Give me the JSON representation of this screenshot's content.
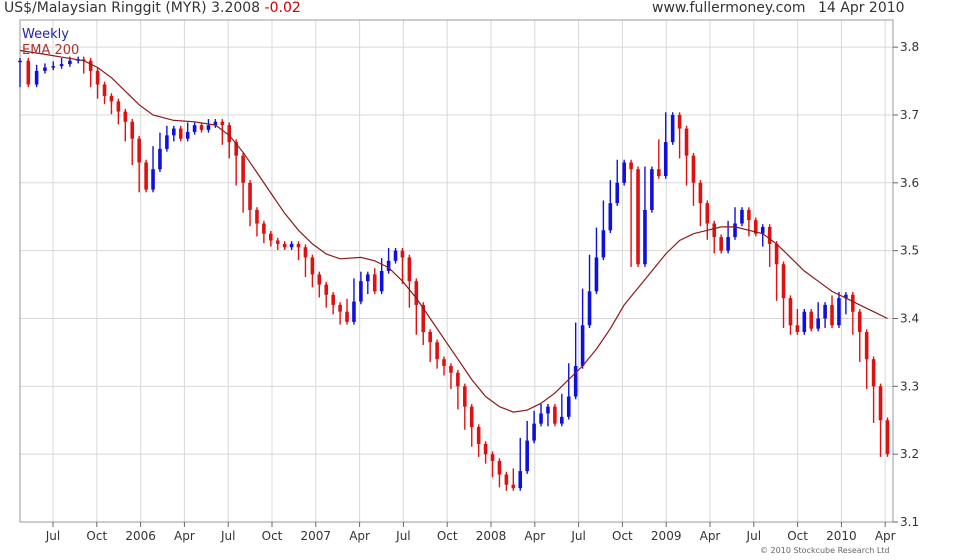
{
  "header": {
    "instrument": "US$/Malaysian Ringgit (MYR) 3.2008",
    "change": "-0.02",
    "website": "www.fullermoney.com",
    "date": "14 Apr 2010"
  },
  "legend": {
    "weekly": "Weekly",
    "ema": "EMA 200"
  },
  "copyright": "© 2010 Stockcube Research Ltd",
  "colors": {
    "up": "#1010dd",
    "down": "#e01010",
    "ema": "#8b1a1a",
    "grid": "#d8d8d8"
  },
  "chart_data": {
    "type": "candlestick",
    "x_tick_labels": [
      "Jul",
      "Oct",
      "2006",
      "Apr",
      "Jul",
      "Oct",
      "2007",
      "Apr",
      "Jul",
      "Oct",
      "2008",
      "Apr",
      "Jul",
      "Oct",
      "2009",
      "Apr",
      "Jul",
      "Oct",
      "2010",
      "Apr"
    ],
    "y_ticks": [
      3.1,
      3.2,
      3.3,
      3.4,
      3.5,
      3.6,
      3.7,
      3.8
    ],
    "ylim": [
      3.1,
      3.84
    ],
    "y_axis_side": "right",
    "grid": true,
    "series": [
      {
        "name": "Weekly",
        "points": [
          [
            2005.54,
            3.78
          ],
          [
            2005.6,
            3.745
          ],
          [
            2005.66,
            3.765
          ],
          [
            2005.72,
            3.77
          ],
          [
            2005.78,
            3.772
          ],
          [
            2005.84,
            3.775
          ],
          [
            2005.9,
            3.78
          ],
          [
            2005.96,
            3.782
          ],
          [
            2006.0,
            3.78
          ],
          [
            2006.05,
            3.765
          ],
          [
            2006.1,
            3.745
          ],
          [
            2006.15,
            3.728
          ],
          [
            2006.2,
            3.72
          ],
          [
            2006.25,
            3.705
          ],
          [
            2006.3,
            3.69
          ],
          [
            2006.35,
            3.665
          ],
          [
            2006.4,
            3.63
          ],
          [
            2006.45,
            3.59
          ],
          [
            2006.5,
            3.62
          ],
          [
            2006.55,
            3.65
          ],
          [
            2006.6,
            3.67
          ],
          [
            2006.65,
            3.68
          ],
          [
            2006.7,
            3.665
          ],
          [
            2006.75,
            3.675
          ],
          [
            2006.8,
            3.685
          ],
          [
            2006.85,
            3.678
          ],
          [
            2006.9,
            3.685
          ],
          [
            2006.95,
            3.69
          ],
          [
            2007.0,
            3.685
          ],
          [
            2007.05,
            3.66
          ],
          [
            2007.1,
            3.64
          ],
          [
            2007.15,
            3.6
          ],
          [
            2007.2,
            3.56
          ],
          [
            2007.25,
            3.54
          ],
          [
            2007.3,
            3.525
          ],
          [
            2007.35,
            3.515
          ],
          [
            2007.4,
            3.51
          ],
          [
            2007.45,
            3.505
          ],
          [
            2007.5,
            3.51
          ],
          [
            2007.55,
            3.505
          ],
          [
            2007.6,
            3.49
          ],
          [
            2007.65,
            3.465
          ],
          [
            2007.7,
            3.45
          ],
          [
            2007.75,
            3.435
          ],
          [
            2007.8,
            3.42
          ],
          [
            2007.85,
            3.41
          ],
          [
            2007.9,
            3.395
          ],
          [
            2007.95,
            3.425
          ],
          [
            2008.0,
            3.455
          ],
          [
            2008.05,
            3.465
          ],
          [
            2008.1,
            3.44
          ],
          [
            2008.15,
            3.47
          ],
          [
            2008.2,
            3.485
          ],
          [
            2008.25,
            3.5
          ],
          [
            2008.3,
            3.49
          ],
          [
            2008.35,
            3.455
          ],
          [
            2008.4,
            3.42
          ],
          [
            2008.45,
            3.38
          ],
          [
            2008.5,
            3.365
          ],
          [
            2008.55,
            3.34
          ],
          [
            2008.6,
            3.33
          ],
          [
            2008.65,
            3.32
          ],
          [
            2008.7,
            3.3
          ],
          [
            2008.75,
            3.27
          ],
          [
            2008.8,
            3.24
          ],
          [
            2008.85,
            3.215
          ],
          [
            2008.9,
            3.2
          ],
          [
            2008.95,
            3.19
          ],
          [
            2009.0,
            3.17
          ],
          [
            2009.05,
            3.155
          ],
          [
            2009.1,
            3.15
          ],
          [
            2009.15,
            3.175
          ],
          [
            2009.2,
            3.22
          ],
          [
            2009.25,
            3.245
          ],
          [
            2009.3,
            3.26
          ],
          [
            2009.35,
            3.27
          ],
          [
            2009.4,
            3.245
          ],
          [
            2009.45,
            3.255
          ],
          [
            2009.5,
            3.285
          ],
          [
            2009.55,
            3.33
          ],
          [
            2009.6,
            3.39
          ],
          [
            2009.65,
            3.44
          ],
          [
            2009.7,
            3.49
          ],
          [
            2009.75,
            3.53
          ],
          [
            2009.8,
            3.57
          ],
          [
            2009.85,
            3.6
          ],
          [
            2009.9,
            3.63
          ],
          [
            2009.95,
            3.62
          ],
          [
            2010.0,
            3.48
          ],
          [
            2010.05,
            3.56
          ],
          [
            2010.1,
            3.62
          ],
          [
            2010.15,
            3.61
          ],
          [
            2010.2,
            3.66
          ],
          [
            2010.25,
            3.7
          ],
          [
            2010.3,
            3.68
          ],
          [
            2010.35,
            3.64
          ],
          [
            2010.4,
            3.6
          ],
          [
            2010.45,
            3.57
          ],
          [
            2010.5,
            3.54
          ],
          [
            2010.55,
            3.52
          ],
          [
            2010.6,
            3.5
          ],
          [
            2010.65,
            3.52
          ],
          [
            2010.7,
            3.54
          ],
          [
            2010.75,
            3.56
          ],
          [
            2010.8,
            3.545
          ],
          [
            2010.85,
            3.525
          ],
          [
            2010.9,
            3.535
          ],
          [
            2010.95,
            3.51
          ],
          [
            2011.0,
            3.48
          ],
          [
            2011.05,
            3.43
          ],
          [
            2011.1,
            3.39
          ],
          [
            2011.15,
            3.38
          ],
          [
            2011.2,
            3.41
          ],
          [
            2011.25,
            3.385
          ],
          [
            2011.3,
            3.4
          ],
          [
            2011.35,
            3.42
          ],
          [
            2011.4,
            3.39
          ],
          [
            2011.45,
            3.43
          ],
          [
            2011.5,
            3.435
          ],
          [
            2011.55,
            3.41
          ],
          [
            2011.6,
            3.38
          ],
          [
            2011.65,
            3.34
          ],
          [
            2011.7,
            3.3
          ],
          [
            2011.75,
            3.25
          ],
          [
            2011.8,
            3.2
          ]
        ]
      },
      {
        "name": "EMA 200",
        "points": [
          [
            2005.54,
            3.795
          ],
          [
            2005.7,
            3.79
          ],
          [
            2005.85,
            3.785
          ],
          [
            2006.0,
            3.78
          ],
          [
            2006.1,
            3.77
          ],
          [
            2006.2,
            3.755
          ],
          [
            2006.3,
            3.735
          ],
          [
            2006.4,
            3.715
          ],
          [
            2006.5,
            3.7
          ],
          [
            2006.65,
            3.692
          ],
          [
            2006.8,
            3.69
          ],
          [
            2006.95,
            3.685
          ],
          [
            2007.05,
            3.67
          ],
          [
            2007.15,
            3.645
          ],
          [
            2007.25,
            3.615
          ],
          [
            2007.35,
            3.585
          ],
          [
            2007.45,
            3.555
          ],
          [
            2007.55,
            3.53
          ],
          [
            2007.65,
            3.51
          ],
          [
            2007.75,
            3.495
          ],
          [
            2007.85,
            3.488
          ],
          [
            2008.0,
            3.49
          ],
          [
            2008.1,
            3.485
          ],
          [
            2008.2,
            3.475
          ],
          [
            2008.3,
            3.455
          ],
          [
            2008.4,
            3.43
          ],
          [
            2008.5,
            3.4
          ],
          [
            2008.6,
            3.37
          ],
          [
            2008.7,
            3.34
          ],
          [
            2008.8,
            3.31
          ],
          [
            2008.9,
            3.285
          ],
          [
            2009.0,
            3.27
          ],
          [
            2009.1,
            3.262
          ],
          [
            2009.2,
            3.265
          ],
          [
            2009.3,
            3.275
          ],
          [
            2009.4,
            3.29
          ],
          [
            2009.5,
            3.31
          ],
          [
            2009.6,
            3.33
          ],
          [
            2009.7,
            3.355
          ],
          [
            2009.8,
            3.385
          ],
          [
            2009.9,
            3.42
          ],
          [
            2010.0,
            3.445
          ],
          [
            2010.1,
            3.47
          ],
          [
            2010.2,
            3.495
          ],
          [
            2010.3,
            3.515
          ],
          [
            2010.4,
            3.525
          ],
          [
            2010.5,
            3.53
          ],
          [
            2010.6,
            3.535
          ],
          [
            2010.7,
            3.535
          ],
          [
            2010.8,
            3.53
          ],
          [
            2010.9,
            3.525
          ],
          [
            2011.0,
            3.51
          ],
          [
            2011.1,
            3.49
          ],
          [
            2011.2,
            3.47
          ],
          [
            2011.3,
            3.455
          ],
          [
            2011.4,
            3.44
          ],
          [
            2011.5,
            3.43
          ],
          [
            2011.6,
            3.42
          ],
          [
            2011.7,
            3.41
          ],
          [
            2011.8,
            3.4
          ]
        ]
      }
    ]
  }
}
